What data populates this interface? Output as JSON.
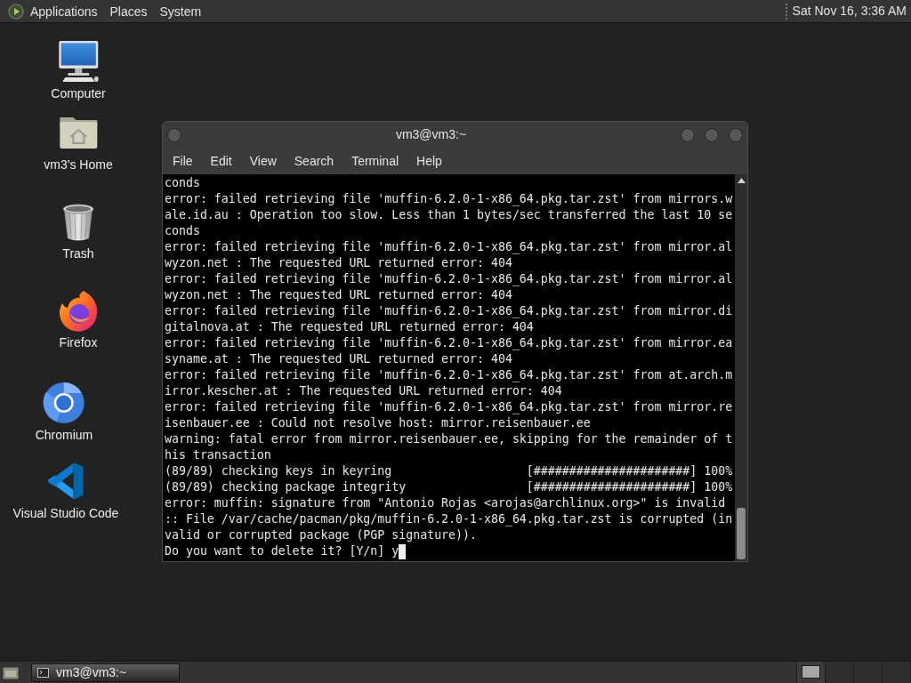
{
  "top_panel": {
    "menus": [
      "Applications",
      "Places",
      "System"
    ],
    "clock": "Sat Nov 16, 3:36 AM"
  },
  "desktop_icons": [
    {
      "label": "Computer",
      "kind": "computer"
    },
    {
      "label": "vm3's Home",
      "kind": "home"
    },
    {
      "label": "Trash",
      "kind": "trash"
    },
    {
      "label": "Firefox",
      "kind": "firefox"
    },
    {
      "label": "Chromium",
      "kind": "chromium"
    },
    {
      "label": "Visual Studio Code",
      "kind": "vscode"
    }
  ],
  "terminal": {
    "title": "vm3@vm3:~",
    "menu": [
      "File",
      "Edit",
      "View",
      "Search",
      "Terminal",
      "Help"
    ],
    "lines": [
      "conds",
      "error: failed retrieving file 'muffin-6.2.0-1-x86_64.pkg.tar.zst' from mirrors.w",
      "ale.id.au : Operation too slow. Less than 1 bytes/sec transferred the last 10 se",
      "conds",
      "error: failed retrieving file 'muffin-6.2.0-1-x86_64.pkg.tar.zst' from mirror.al",
      "wyzon.net : The requested URL returned error: 404",
      "error: failed retrieving file 'muffin-6.2.0-1-x86_64.pkg.tar.zst' from mirror.al",
      "wyzon.net : The requested URL returned error: 404",
      "error: failed retrieving file 'muffin-6.2.0-1-x86_64.pkg.tar.zst' from mirror.di",
      "gitalnova.at : The requested URL returned error: 404",
      "error: failed retrieving file 'muffin-6.2.0-1-x86_64.pkg.tar.zst' from mirror.ea",
      "syname.at : The requested URL returned error: 404",
      "error: failed retrieving file 'muffin-6.2.0-1-x86_64.pkg.tar.zst' from at.arch.m",
      "irror.kescher.at : The requested URL returned error: 404",
      "error: failed retrieving file 'muffin-6.2.0-1-x86_64.pkg.tar.zst' from mirror.re",
      "isenbauer.ee : Could not resolve host: mirror.reisenbauer.ee",
      "warning: fatal error from mirror.reisenbauer.ee, skipping for the remainder of t",
      "his transaction",
      "(89/89) checking keys in keyring                   [######################] 100%",
      "(89/89) checking package integrity                 [######################] 100%",
      "error: muffin: signature from \"Antonio Rojas <arojas@archlinux.org>\" is invalid",
      ":: File /var/cache/pacman/pkg/muffin-6.2.0-1-x86_64.pkg.tar.zst is corrupted (in",
      "valid or corrupted package (PGP signature)).",
      "Do you want to delete it? [Y/n] y"
    ],
    "cursor": true
  },
  "bottom_panel": {
    "tasks": [
      {
        "label": "vm3@vm3:~",
        "selected": true
      }
    ],
    "workspaces": [
      {
        "selected": true
      },
      {
        "selected": false
      },
      {
        "selected": false
      },
      {
        "selected": false
      }
    ]
  }
}
